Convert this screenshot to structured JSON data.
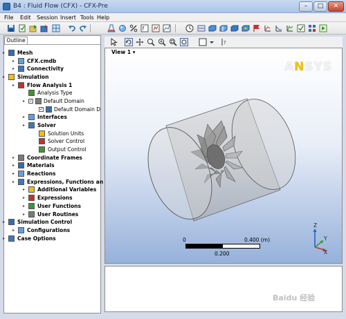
{
  "window": {
    "title": "B4 : Fluid Flow (CFX) - CFX-Pre",
    "controls": {
      "minimize": "–",
      "maximize": "□",
      "close": "✕"
    }
  },
  "menu": [
    "File",
    "Edit",
    "Session",
    "Insert",
    "Tools",
    "Help"
  ],
  "toolbar": {
    "icons": [
      "save-icon",
      "new-icon",
      "import-icon",
      "export-icon",
      "undo-icon",
      "redo-icon",
      "mesh-icon",
      "flask-icon",
      "material-icon",
      "percent-icon",
      "expression-icon",
      "user-function-icon",
      "clock-icon",
      "boundary-icon",
      "domain-icon",
      "interface-icon",
      "source-icon",
      "monitor-icon",
      "solver-control-icon",
      "graph-icon",
      "output-icon",
      "check-icon",
      "run-icon"
    ]
  },
  "outline": {
    "tab_label": "Outline",
    "tree": [
      {
        "label": "Mesh",
        "bold": true,
        "indent": 0,
        "icon": "mesh-icon"
      },
      {
        "label": "CFX.cmdb",
        "bold": true,
        "indent": 1,
        "icon": "mesh-file-icon"
      },
      {
        "label": "Connectivity",
        "bold": true,
        "indent": 1,
        "icon": "connectivity-icon"
      },
      {
        "label": "Simulation",
        "bold": true,
        "indent": 0,
        "icon": "simulation-icon"
      },
      {
        "label": "Flow Analysis 1",
        "bold": true,
        "indent": 1,
        "icon": "flow-analysis-icon"
      },
      {
        "label": "Analysis Type",
        "bold": false,
        "indent": 2,
        "icon": "clock-icon"
      },
      {
        "label": "Default Domain",
        "bold": false,
        "indent": 2,
        "icon": "domain-icon",
        "checked": true
      },
      {
        "label": "Default Domain D",
        "bold": false,
        "indent": 3,
        "icon": "boundary-icon",
        "checked": true
      },
      {
        "label": "Interfaces",
        "bold": true,
        "indent": 2,
        "icon": "interface-icon"
      },
      {
        "label": "Solver",
        "bold": true,
        "indent": 2,
        "icon": "solver-icon"
      },
      {
        "label": "Solution Units",
        "bold": false,
        "indent": 3,
        "icon": "units-icon"
      },
      {
        "label": "Solver Control",
        "bold": false,
        "indent": 3,
        "icon": "solver-control-icon"
      },
      {
        "label": "Output Control",
        "bold": false,
        "indent": 3,
        "icon": "output-control-icon"
      },
      {
        "label": "Coordinate Frames",
        "bold": true,
        "indent": 1,
        "icon": "coordinate-frame-icon"
      },
      {
        "label": "Materials",
        "bold": true,
        "indent": 1,
        "icon": "materials-icon"
      },
      {
        "label": "Reactions",
        "bold": true,
        "indent": 1,
        "icon": "reactions-icon"
      },
      {
        "label": "Expressions, Functions an",
        "bold": true,
        "indent": 1,
        "icon": "expressions-folder-icon"
      },
      {
        "label": "Additional Variables",
        "bold": true,
        "indent": 2,
        "icon": "variables-icon"
      },
      {
        "label": "Expressions",
        "bold": true,
        "indent": 2,
        "icon": "expressions-icon"
      },
      {
        "label": "User Functions",
        "bold": true,
        "indent": 2,
        "icon": "user-functions-icon"
      },
      {
        "label": "User Routines",
        "bold": true,
        "indent": 2,
        "icon": "user-routines-icon"
      },
      {
        "label": "Simulation Control",
        "bold": true,
        "indent": 0,
        "icon": "simulation-control-icon"
      },
      {
        "label": "Configurations",
        "bold": true,
        "indent": 1,
        "icon": "configurations-icon"
      },
      {
        "label": "Case Options",
        "bold": true,
        "indent": 0,
        "icon": "case-options-icon"
      }
    ]
  },
  "viewer": {
    "view_label": "View 1 ▾",
    "logo": {
      "prefix": "A",
      "accent": "N",
      "suffix": "SYS"
    },
    "scale": {
      "left": "0",
      "right": "0.400  (m)",
      "middle": "0.200"
    },
    "axes": {
      "z": "Z",
      "y": "Y",
      "x": "X"
    }
  },
  "watermark": "Baidu 经验",
  "colors": {
    "accent": "#2e6fb6",
    "logo": "#f2c200",
    "viewport_bottom": "#96b1db"
  }
}
